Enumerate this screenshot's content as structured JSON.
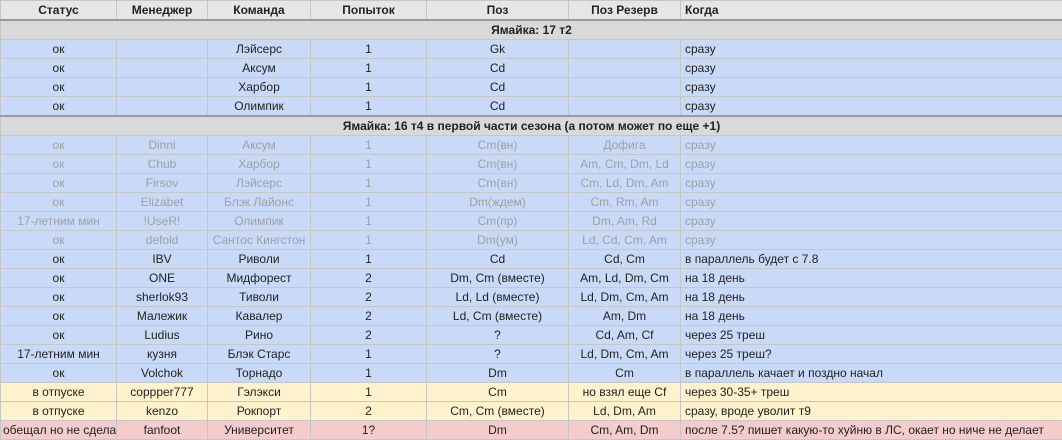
{
  "headers": [
    "Статус",
    "Менеджер",
    "Команда",
    "Попыток",
    "Поз",
    "Поз Резерв",
    "Когда"
  ],
  "sections": [
    {
      "title": "Ямайка: 17 т2",
      "rows": [
        {
          "status": "ок",
          "manager": "",
          "team": "Лэйсерс",
          "tries": "1",
          "pos": "Gk",
          "reserve": "",
          "when": "сразу",
          "style": "blue"
        },
        {
          "status": "ок",
          "manager": "",
          "team": "Аксум",
          "tries": "1",
          "pos": "Cd",
          "reserve": "",
          "when": "сразу",
          "style": "blue"
        },
        {
          "status": "ок",
          "manager": "",
          "team": "Харбор",
          "tries": "1",
          "pos": "Cd",
          "reserve": "",
          "when": "сразу",
          "style": "blue"
        },
        {
          "status": "ок",
          "manager": "",
          "team": "Олимпик",
          "tries": "1",
          "pos": "Cd",
          "reserve": "",
          "when": "сразу",
          "style": "blue"
        }
      ]
    },
    {
      "title": "Ямайка: 16 т4 в первой части сезона (а потом может по еще +1)",
      "rows": [
        {
          "status": "ок",
          "manager": "Dinni",
          "team": "Аксум",
          "tries": "1",
          "pos": "Cm(вн)",
          "reserve": "Дофига",
          "when": "сразу",
          "style": "blue dim"
        },
        {
          "status": "ок",
          "manager": "Chub",
          "team": "Харбор",
          "tries": "1",
          "pos": "Cm(вн)",
          "reserve": "Am, Cm, Dm, Ld",
          "when": "сразу",
          "style": "blue dim"
        },
        {
          "status": "ок",
          "manager": "Firsov",
          "team": "Лэйсерс",
          "tries": "1",
          "pos": "Cm(вн)",
          "reserve": "Cm, Ld, Dm, Am",
          "when": "сразу",
          "style": "blue dim"
        },
        {
          "status": "ок",
          "manager": "Elizabet",
          "team": "Блэк Лайонс",
          "tries": "1",
          "pos": "Dm(ждем)",
          "reserve": "Cm, Rm, Am",
          "when": "сразу",
          "style": "blue dim"
        },
        {
          "status": "17-летним мин",
          "manager": "!UseR!",
          "team": "Олимпик",
          "tries": "1",
          "pos": "Cm(пр)",
          "reserve": "Dm, Am, Rd",
          "when": "сразу",
          "style": "blue dim"
        },
        {
          "status": "ок",
          "manager": "defold",
          "team": "Сантос Кингстон",
          "tries": "1",
          "pos": "Dm(ум)",
          "reserve": "Ld, Cd, Cm, Am",
          "when": "сразу",
          "style": "blue dim"
        },
        {
          "status": "ок",
          "manager": "IBV",
          "team": "Риволи",
          "tries": "1",
          "pos": "Cd",
          "reserve": "Cd, Cm",
          "when": "в параллель будет с 7.8",
          "style": "blue"
        },
        {
          "status": "ок",
          "manager": "ONE",
          "team": "Мидфорест",
          "tries": "2",
          "pos": "Dm, Cm (вместе)",
          "reserve": "Am, Ld, Dm, Cm",
          "when": "на 18 день",
          "style": "blue"
        },
        {
          "status": "ок",
          "manager": "sherlok93",
          "team": "Тиволи",
          "tries": "2",
          "pos": "Ld, Ld (вместе)",
          "reserve": "Ld, Dm, Cm, Am",
          "when": "на 18 день",
          "style": "blue"
        },
        {
          "status": "ок",
          "manager": "Малежик",
          "team": "Кавалер",
          "tries": "2",
          "pos": "Ld, Cm (вместе)",
          "reserve": "Am, Dm",
          "when": "на 18 день",
          "style": "blue"
        },
        {
          "status": "ок",
          "manager": "Ludius",
          "team": "Рино",
          "tries": "2",
          "pos": "?",
          "reserve": "Cd, Am, Cf",
          "when": "через 25 треш",
          "style": "blue"
        },
        {
          "status": "17-летним мин",
          "manager": "кузня",
          "team": "Блэк Старс",
          "tries": "1",
          "pos": "?",
          "reserve": "Ld, Dm, Cm, Am",
          "when": "через 25 треш?",
          "style": "blue"
        },
        {
          "status": "ок",
          "manager": "Volchok",
          "team": "Торнадо",
          "tries": "1",
          "pos": "Dm",
          "reserve": "Cm",
          "when": "в параллель качает и поздно начал",
          "style": "blue"
        },
        {
          "status": "в отпуске",
          "manager": "coppper777",
          "team": "Гэлэкси",
          "tries": "1",
          "pos": "Cm",
          "reserve": "но взял еще Cf",
          "when": "через 30-35+ треш",
          "style": "yellow"
        },
        {
          "status": "в отпуске",
          "manager": "kenzo",
          "team": "Рокпорт",
          "tries": "2",
          "pos": "Cm, Cm (вместе)",
          "reserve": "Ld, Dm, Am",
          "when": "сразу, вроде уволит т9",
          "style": "yellow"
        },
        {
          "status": "обещал но не сделал",
          "manager": "fanfoot",
          "team": "Университет",
          "tries": "1?",
          "pos": "Dm",
          "reserve": "Cm, Am, Dm",
          "when": "после 7.5? пишет какую-то хуйню в ЛС, окает но ниче не делает",
          "style": "red"
        }
      ]
    }
  ]
}
